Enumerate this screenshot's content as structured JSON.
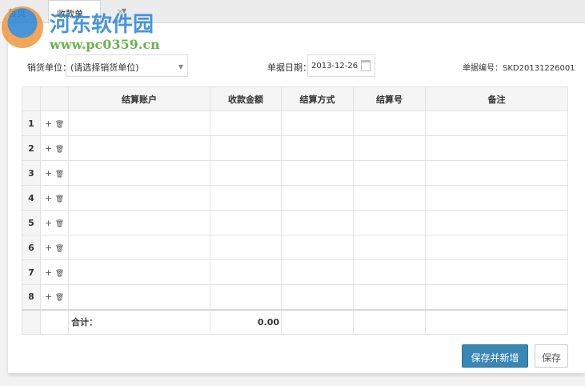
{
  "tabs": [
    {
      "label": "首页"
    },
    {
      "label": "收款单",
      "close": "×"
    }
  ],
  "watermark": {
    "title": "河东软件园",
    "url": "www.pc0359.cn"
  },
  "form": {
    "seller_label": "销货单位：",
    "seller_placeholder": "(请选择销货单位)",
    "date_label": "单据日期：",
    "date_value": "2013-12-26",
    "no_label": "单据编号：",
    "no_value": "SKD20131226001"
  },
  "table": {
    "headers": [
      "结算账户",
      "收款金额",
      "结算方式",
      "结算号",
      "备注"
    ],
    "rows": [
      "1",
      "2",
      "3",
      "4",
      "5",
      "6",
      "7",
      "8"
    ],
    "add_icon": "+",
    "delete_icon": "🗑",
    "total_label": "合计：",
    "total_amount": "0.00"
  },
  "buttons": {
    "save_new": "保存并新增",
    "save": "保存"
  }
}
